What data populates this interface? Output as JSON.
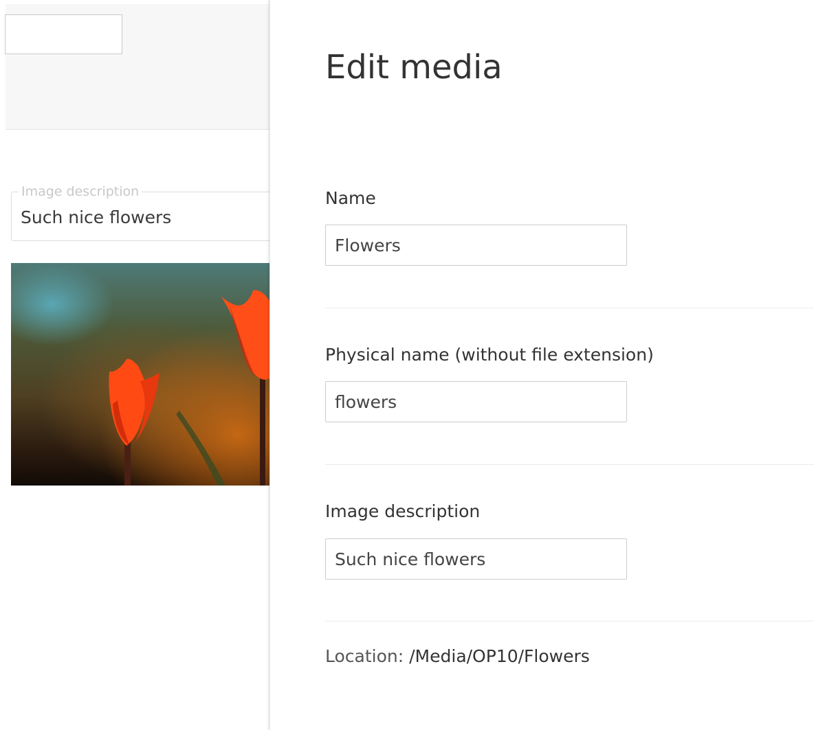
{
  "background": {
    "fieldset": {
      "legend": "Image description",
      "value": "Such nice flowers"
    },
    "photo_alt": "tulips-photo"
  },
  "panel": {
    "title": "Edit media",
    "name_field": {
      "label": "Name",
      "value": "Flowers"
    },
    "physical_name_field": {
      "label": "Physical name (without file extension)",
      "value": "flowers"
    },
    "description_field": {
      "label": "Image description",
      "value": "Such nice flowers"
    },
    "location": {
      "label": "Location:",
      "value": "/Media/OP10/Flowers"
    }
  },
  "colors": {
    "text": "#333333",
    "border": "#cccccc",
    "tulip": "#ff4a14"
  }
}
